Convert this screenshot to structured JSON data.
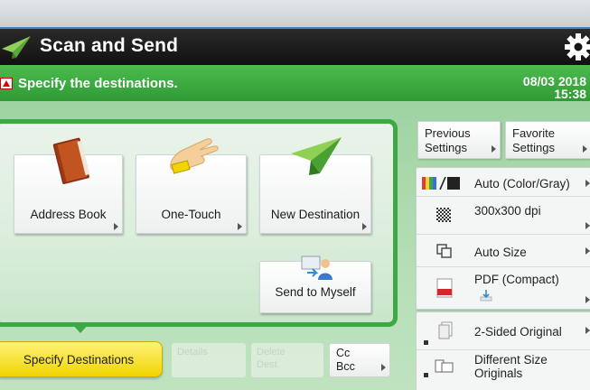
{
  "header": {
    "title": "Scan and Send",
    "logo_icon": "paper-plane-icon",
    "settings_icon": "gear-icon"
  },
  "instruction": {
    "text": "Specify the destinations.",
    "date": "08/03 2018",
    "time": "15:38"
  },
  "destinations": {
    "address_book": "Address Book",
    "one_touch": "One-Touch",
    "new_destination": "New Destination",
    "send_to_myself": "Send to Myself"
  },
  "tabs": {
    "specify": "Specify Destinations",
    "details": "Details",
    "delete_line1": "Delete",
    "delete_line2": "Dest.",
    "cc": "Cc",
    "bcc": "Bcc"
  },
  "settings": {
    "previous_line1": "Previous",
    "previous_line2": "Settings",
    "favorite_line1": "Favorite",
    "favorite_line2": "Settings",
    "color_mode": "Auto (Color/Gray)",
    "resolution": "300x300 dpi",
    "scan_size": "Auto Size",
    "file_format": "PDF (Compact)",
    "two_sided": "2-Sided Original",
    "different_size_line1": "Different Size",
    "different_size_line2": "Originals"
  },
  "colors": {
    "accent_green": "#3da844",
    "title_bar": "#111111",
    "primary_button": "#f0d400"
  }
}
